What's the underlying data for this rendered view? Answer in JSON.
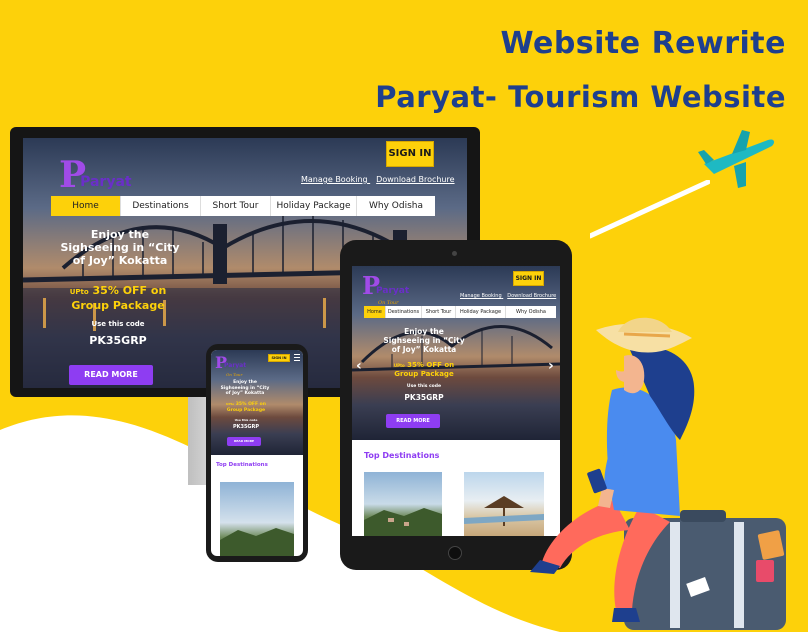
{
  "header": {
    "title": "Website Rewrite",
    "subtitle": "Paryat- Tourism Website"
  },
  "site": {
    "logo_text": "Paryat",
    "logo_tagline": "On Tour",
    "signin": "SIGN IN",
    "manage_booking": "Manage Booking",
    "download_brochure": "Download Brochure",
    "nav": [
      "Home",
      "Destinations",
      "Short Tour",
      "Holiday Package",
      "Why Odisha"
    ],
    "hero_line1": "Enjoy the",
    "hero_line2": "Sighseeing in “City",
    "hero_line3": "of Joy” Kokatta",
    "offer_prefix": "UPto",
    "offer_main": "35% OFF on",
    "offer_line2": "Group Package",
    "code_label": "Use this code",
    "code": "PK35GRP",
    "read_more": "READ MORE",
    "top_destinations": "Top Destinations",
    "prev_arrow": "‹",
    "next_arrow": "›"
  },
  "colors": {
    "background": "#FDD10A",
    "headline": "#1E3F8E",
    "accent_purple": "#8E3DF2",
    "signin_yellow": "#FDD10A"
  },
  "icons": [
    "airplane-icon",
    "menu-icon",
    "chevron-left-icon",
    "chevron-right-icon"
  ]
}
